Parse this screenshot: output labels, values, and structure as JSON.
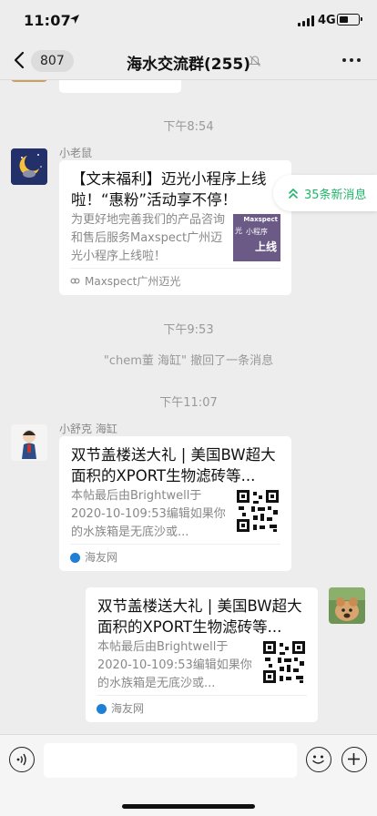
{
  "status_bar": {
    "time": "11:07",
    "network": "4G",
    "icons": [
      "location-arrow-icon",
      "signal-icon",
      "battery-icon"
    ]
  },
  "nav": {
    "unread_count": "807",
    "title": "海水交流群(255)",
    "icons": [
      "back-arrow-icon",
      "mute-icon",
      "more-icon"
    ]
  },
  "new_messages_badge": "35条新消息",
  "chat": {
    "time_1": "下午8:54",
    "msg_1": {
      "sender": "小老鼠",
      "card_title": "【文末福利】迈光小程序上线啦！“惠粉”活动享不停！",
      "card_desc": "为更好地完善我们的产品咨询和售后服务Maxspect广州迈光小程序上线啦！",
      "thumb_text_1": "Maxspect",
      "thumb_text_2": "光",
      "thumb_text_3": "小程序",
      "thumb_text_4": "上线",
      "source": "Maxspect广州迈光"
    },
    "time_2": "下午9:53",
    "system_recall": "\"chem董 海缸\" 撤回了一条消息",
    "time_3": "下午11:07",
    "msg_2": {
      "sender": "小舒克 海缸",
      "card_title": "双节盖楼送大礼 | 美国BW超大面积的XPORT生物滤砖等...",
      "card_desc": "本帖最后由Brightwell于2020-10-109:53编辑如果你的水族箱是无底沙或...",
      "source": "海友网"
    },
    "msg_3": {
      "card_title": "双节盖楼送大礼 | 美国BW超大面积的XPORT生物滤砖等...",
      "card_desc": "本帖最后由Brightwell于2020-10-109:53编辑如果你的水族箱是无底沙或...",
      "source": "海友网"
    }
  },
  "input_bar": {
    "placeholder": "",
    "icons": [
      "voice-icon",
      "emoji-icon",
      "plus-icon"
    ]
  },
  "colors": {
    "background": "#ededed",
    "accent_green": "#20b56b",
    "card_white": "#ffffff",
    "muted_text": "#999999"
  }
}
